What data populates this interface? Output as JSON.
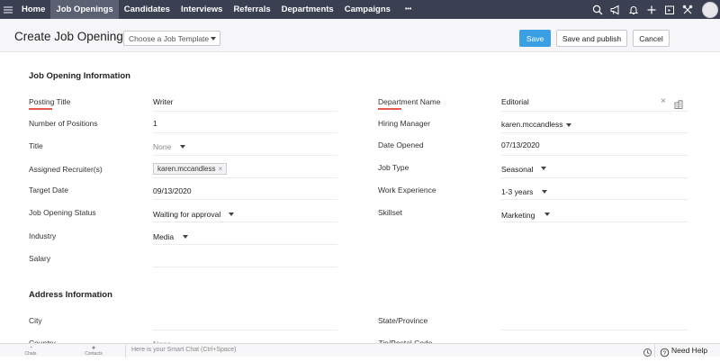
{
  "nav": {
    "tabs": [
      "Home",
      "Job Openings",
      "Candidates",
      "Interviews",
      "Referrals",
      "Departments",
      "Campaigns"
    ],
    "more": "•••",
    "active_index": 1,
    "icons": [
      "search-icon",
      "megaphone-icon",
      "bell-icon",
      "plus-icon",
      "calendar-icon",
      "tools-icon",
      "avatar"
    ]
  },
  "header": {
    "title": "Create Job Opening",
    "separator": "-",
    "template_placeholder": "Choose a Job Template",
    "save": "Save",
    "save_publish": "Save and publish",
    "cancel": "Cancel"
  },
  "sections": {
    "job_info": "Job Opening Information",
    "address_info": "Address Information"
  },
  "left_fields": [
    {
      "label": "Posting Title",
      "value": "Writer"
    },
    {
      "label": "Number of Positions",
      "value": "1"
    },
    {
      "label": "Title",
      "value": "None"
    },
    {
      "label": "Assigned Recruiter(s)",
      "value": "karen.mccandless"
    },
    {
      "label": "Target Date",
      "value": "09/13/2020"
    },
    {
      "label": "Job Opening Status",
      "value": "Waiting for approval"
    },
    {
      "label": "Industry",
      "value": "Media"
    },
    {
      "label": "Salary",
      "value": ""
    }
  ],
  "right_fields": [
    {
      "label": "Department Name",
      "value": "Editorial"
    },
    {
      "label": "Hiring Manager",
      "value": "karen.mccandless"
    },
    {
      "label": "Date Opened",
      "value": "07/13/2020"
    },
    {
      "label": "Job Type",
      "value": "Seasonal"
    },
    {
      "label": "Work Experience",
      "value": "1-3 years"
    },
    {
      "label": "Skillset",
      "value": "Marketing"
    }
  ],
  "address_fields": [
    {
      "label": "City",
      "value": ""
    },
    {
      "label": "State/Province",
      "value": ""
    },
    {
      "label": "Country",
      "value": "None"
    },
    {
      "label": "Zip/Postal Code",
      "value": ""
    }
  ],
  "bottom": {
    "chats": "Chats",
    "contacts": "Contacts",
    "smart_chat_placeholder": "Here is your Smart Chat (Ctrl+Space)",
    "need_help": "Need Help"
  },
  "colors": {
    "nav_bg": "#3a3f51",
    "accent": "#3aa0e3",
    "required": "#e25a4f"
  }
}
